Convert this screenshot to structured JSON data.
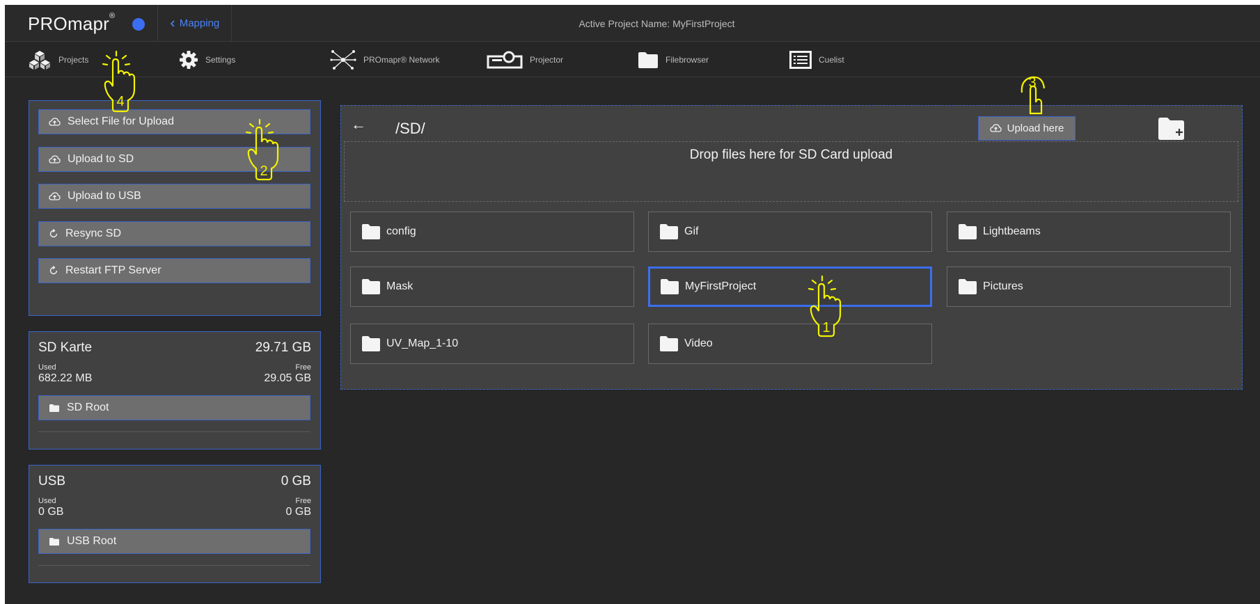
{
  "brand": {
    "name": "PROmapr",
    "mark": "®",
    "accent": "#3b6ef0"
  },
  "top_tab": {
    "label": "Mapping",
    "icon": "caret-left-icon",
    "color": "#4a82f7"
  },
  "active_project": "Active Project Name: MyFirstProject",
  "nav": [
    {
      "label": "Projects",
      "icon": "cubes-icon"
    },
    {
      "label": "Settings",
      "icon": "gear-icon"
    },
    {
      "label": "PROmapr® Network",
      "icon": "network-icon"
    },
    {
      "label": "Projector",
      "icon": "projector-icon"
    },
    {
      "label": "Filebrowser",
      "icon": "folder-icon"
    },
    {
      "label": "Cuelist",
      "icon": "list-icon"
    }
  ],
  "actions": [
    {
      "label": "Select File for Upload",
      "icon": "cloud-upload-icon"
    },
    {
      "label": "Upload to SD",
      "icon": "cloud-upload-icon"
    },
    {
      "label": "Upload to USB",
      "icon": "cloud-upload-icon"
    },
    {
      "label": "Resync SD",
      "icon": "refresh-icon"
    },
    {
      "label": "Restart FTP Server",
      "icon": "refresh-icon"
    }
  ],
  "sd": {
    "title": "SD Karte",
    "total": "29.71 GB",
    "used_label": "Used",
    "used": "682.22 MB",
    "free_label": "Free",
    "free": "29.05 GB",
    "root_button": "SD Root"
  },
  "usb": {
    "title": "USB",
    "total": "0 GB",
    "used_label": "Used",
    "used": "0 GB",
    "free_label": "Free",
    "free": "0 GB",
    "root_button": "USB Root"
  },
  "browser": {
    "back": "←",
    "path": "/SD/",
    "upload_here": "Upload here",
    "dropzone": "Drop files here for SD Card upload",
    "folders": [
      "config",
      "Gif",
      "Lightbeams",
      "Mask",
      "MyFirstProject",
      "Pictures",
      "UV_Map_1-10",
      "Video"
    ],
    "selected_folder": "MyFirstProject"
  },
  "annotations": [
    "1",
    "2",
    "3",
    "4"
  ],
  "colors": {
    "panel": "#414141",
    "border": "#3b63c7",
    "button": "#6e6e6e",
    "annotation": "#f2f200"
  }
}
